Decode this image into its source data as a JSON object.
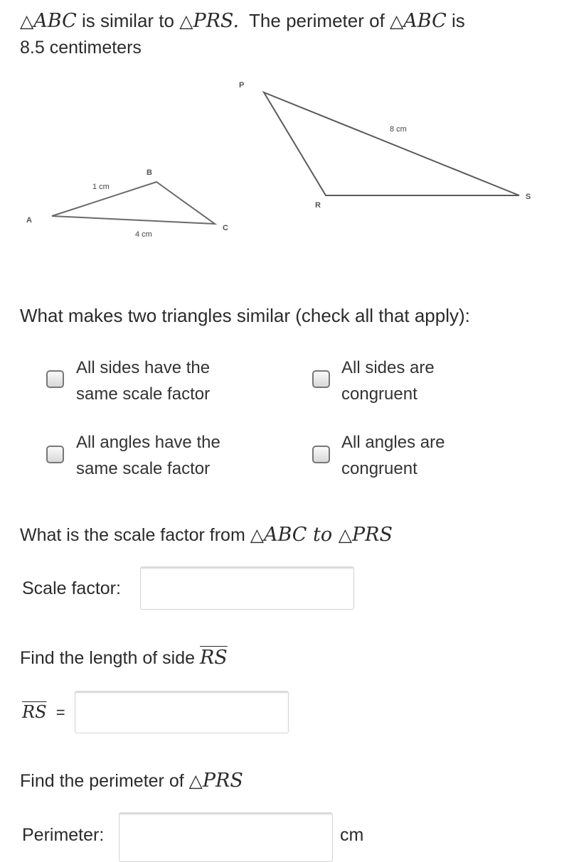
{
  "intro": {
    "tri_abc": "ABC",
    "is_similar_to": " is similar to ",
    "tri_prs": "PRS",
    "period": ".",
    "perimeter_of": "  The perimeter of ",
    "tri_abc2": "ABC",
    "is": " is",
    "line2": "8.5 centimeters",
    "triangle_symbol": "△"
  },
  "figure": {
    "triangle_abc": {
      "vertices": [
        "A",
        "B",
        "C"
      ],
      "side_ab_label": "1 cm",
      "side_ac_label": "4 cm"
    },
    "triangle_prs": {
      "vertices": [
        "P",
        "R",
        "S"
      ],
      "side_ps_label": "8 cm"
    }
  },
  "question1": {
    "prompt": "What makes two triangles similar (check all that apply):",
    "options": [
      {
        "line1": "All sides have the",
        "line2": "same scale factor",
        "checked": false
      },
      {
        "line1": "All sides are",
        "line2": "congruent",
        "checked": false
      },
      {
        "line1": "All angles have the",
        "line2": "same scale factor",
        "checked": false
      },
      {
        "line1": "All angles are",
        "line2": "congruent",
        "checked": false
      }
    ]
  },
  "question2": {
    "prompt": "What is the scale factor from ",
    "tri_abc": "ABC",
    "to": " to ",
    "tri_prs": "PRS",
    "label": "Scale factor:",
    "value": ""
  },
  "question3": {
    "prompt": "Find the length of side ",
    "side": "RS",
    "label_side": "RS",
    "equals": "=",
    "value": ""
  },
  "question4": {
    "prompt": "Find the perimeter of ",
    "tri_prs": "PRS",
    "label": "Perimeter:",
    "value": "",
    "unit": "cm"
  }
}
